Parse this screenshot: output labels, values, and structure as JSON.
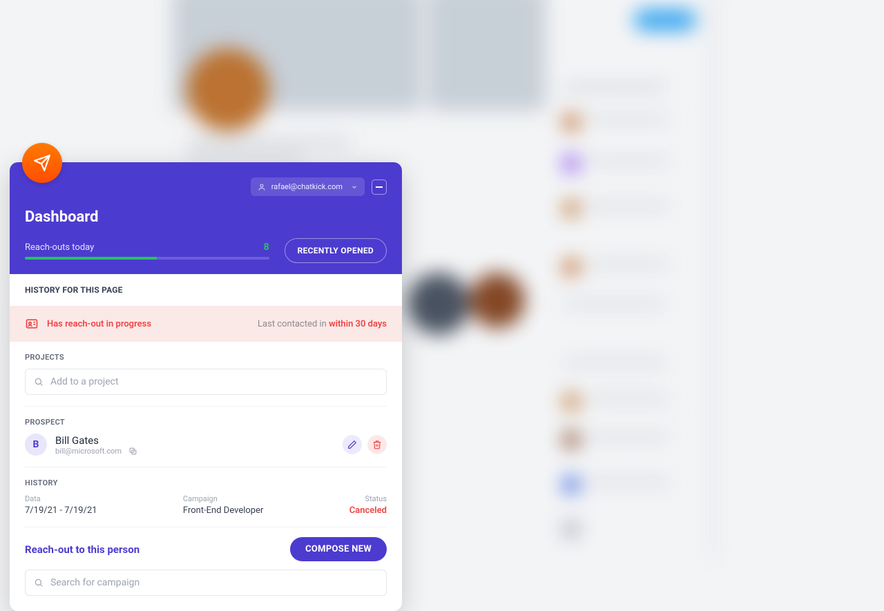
{
  "colors": {
    "primary": "#4c3bcf",
    "accent": "#ff5c00",
    "success": "#22c55e",
    "danger": "#ef4444"
  },
  "user": {
    "email": "rafael@chatkick.com"
  },
  "dashboard": {
    "title": "Dashboard",
    "reachouts_label": "Reach-outs today",
    "reachouts_count": "8",
    "recently_opened_label": "RECENTLY OPENED"
  },
  "history_section": {
    "title": "HISTORY FOR THIS PAGE"
  },
  "alert": {
    "message": "Has reach-out in progress",
    "last_contacted_prefix": "Last contacted in ",
    "last_contacted_em": "within 30 days"
  },
  "projects": {
    "label": "PROJECTS",
    "placeholder": "Add to a project"
  },
  "prospect": {
    "label": "PROSPECT",
    "avatar_letter": "B",
    "name": "Bill Gates",
    "email": "bill@microsoft.com",
    "history_label": "HISTORY",
    "history": {
      "data_label": "Data",
      "data_value": "7/19/21 - 7/19/21",
      "campaign_label": "Campaign",
      "campaign_value": "Front-End Developer",
      "status_label": "Status",
      "status_value": "Canceled"
    }
  },
  "reachout": {
    "title": "Reach-out to this person",
    "compose_label": "COMPOSE NEW",
    "search_placeholder": "Search for campaign"
  }
}
